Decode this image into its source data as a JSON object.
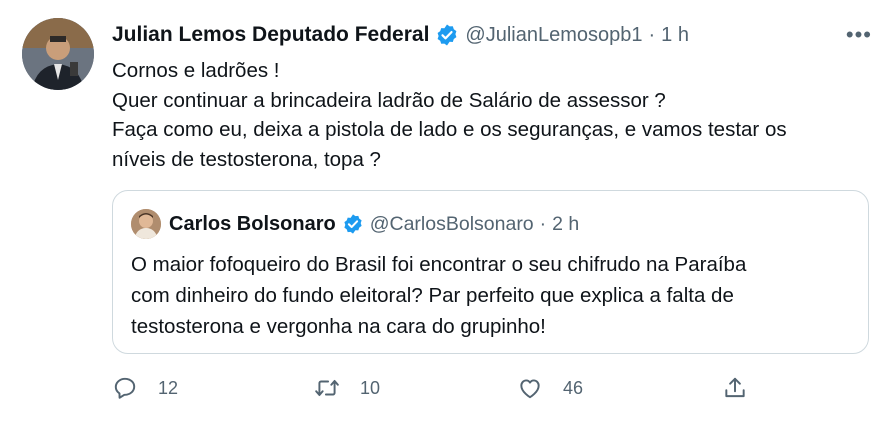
{
  "author": {
    "name": "Julian Lemos Deputado Federal",
    "handle": "@JulianLemosopb1",
    "separator": "·",
    "time": "1 h"
  },
  "more_label": "•••",
  "tweet_lines": [
    "Cornos e ladrões !",
    "Quer continuar a brincadeira ladrão de Salário de assessor ?",
    "Faça como eu, deixa a pistola de lado e os seguranças, e vamos testar os",
    "níveis de testosterona, topa ?"
  ],
  "quoted": {
    "name": "Carlos Bolsonaro",
    "handle": "@CarlosBolsonaro",
    "separator": "·",
    "time": "2 h",
    "lines": [
      "O maior fofoqueiro do Brasil foi encontrar o seu chifrudo na Paraíba",
      "com dinheiro do fundo eleitoral? Par perfeito que explica a falta de",
      "testosterona e vergonha na cara do grupinho!"
    ]
  },
  "actions": {
    "reply_count": "12",
    "retweet_count": "10",
    "like_count": "46"
  },
  "colors": {
    "verified": "#1d9bf0",
    "muted": "#536471",
    "border": "#cfd9de",
    "text": "#0f1419"
  },
  "icons": {
    "verified": "verified-badge-icon",
    "reply": "reply-icon",
    "retweet": "retweet-icon",
    "like": "heart-icon",
    "share": "share-icon",
    "more": "more-options-icon"
  }
}
